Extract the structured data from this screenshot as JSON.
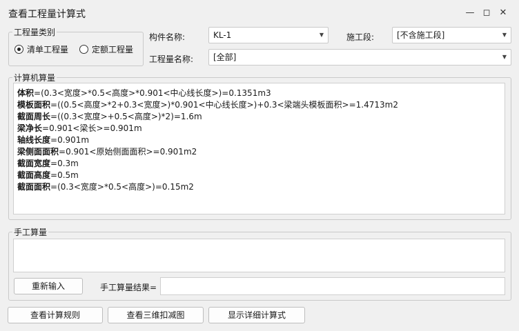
{
  "window": {
    "title": "查看工程量计算式"
  },
  "category": {
    "legend": "工程量类别",
    "options": [
      "清单工程量",
      "定额工程量"
    ],
    "selected": "清单工程量"
  },
  "fields": {
    "component_label": "构件名称:",
    "component_value": "KL-1",
    "stage_label": "施工段:",
    "stage_value": "[不含施工段]",
    "quantity_label": "工程量名称:",
    "quantity_value": "[全部]"
  },
  "machine_calc": {
    "legend": "计算机算量",
    "lines": [
      {
        "name": "体积",
        "expr": "=(0.3<宽度>*0.5<高度>*0.901<中心线长度>)=0.1351m3"
      },
      {
        "name": "模板面积",
        "expr": "=((0.5<高度>*2+0.3<宽度>)*0.901<中心线长度>)+0.3<梁端头模板面积>=1.4713m2"
      },
      {
        "name": "截面周长",
        "expr": "=((0.3<宽度>+0.5<高度>)*2)=1.6m"
      },
      {
        "name": "梁净长",
        "expr": "=0.901<梁长>=0.901m"
      },
      {
        "name": "轴线长度",
        "expr": "=0.901m"
      },
      {
        "name": "梁侧面面积",
        "expr": "=0.901<原始侧面面积>=0.901m2"
      },
      {
        "name": "截面宽度",
        "expr": "=0.3m"
      },
      {
        "name": "截面高度",
        "expr": "=0.5m"
      },
      {
        "name": "截面面积",
        "expr": "=(0.3<宽度>*0.5<高度>)=0.15m2"
      }
    ]
  },
  "manual_calc": {
    "legend": "手工算量",
    "reinput_label": "重新输入",
    "result_label": "手工算量结果="
  },
  "bottom_buttons": {
    "rules": "查看计算规则",
    "deduct3d": "查看三维扣减图",
    "detail": "显示详细计算式"
  }
}
